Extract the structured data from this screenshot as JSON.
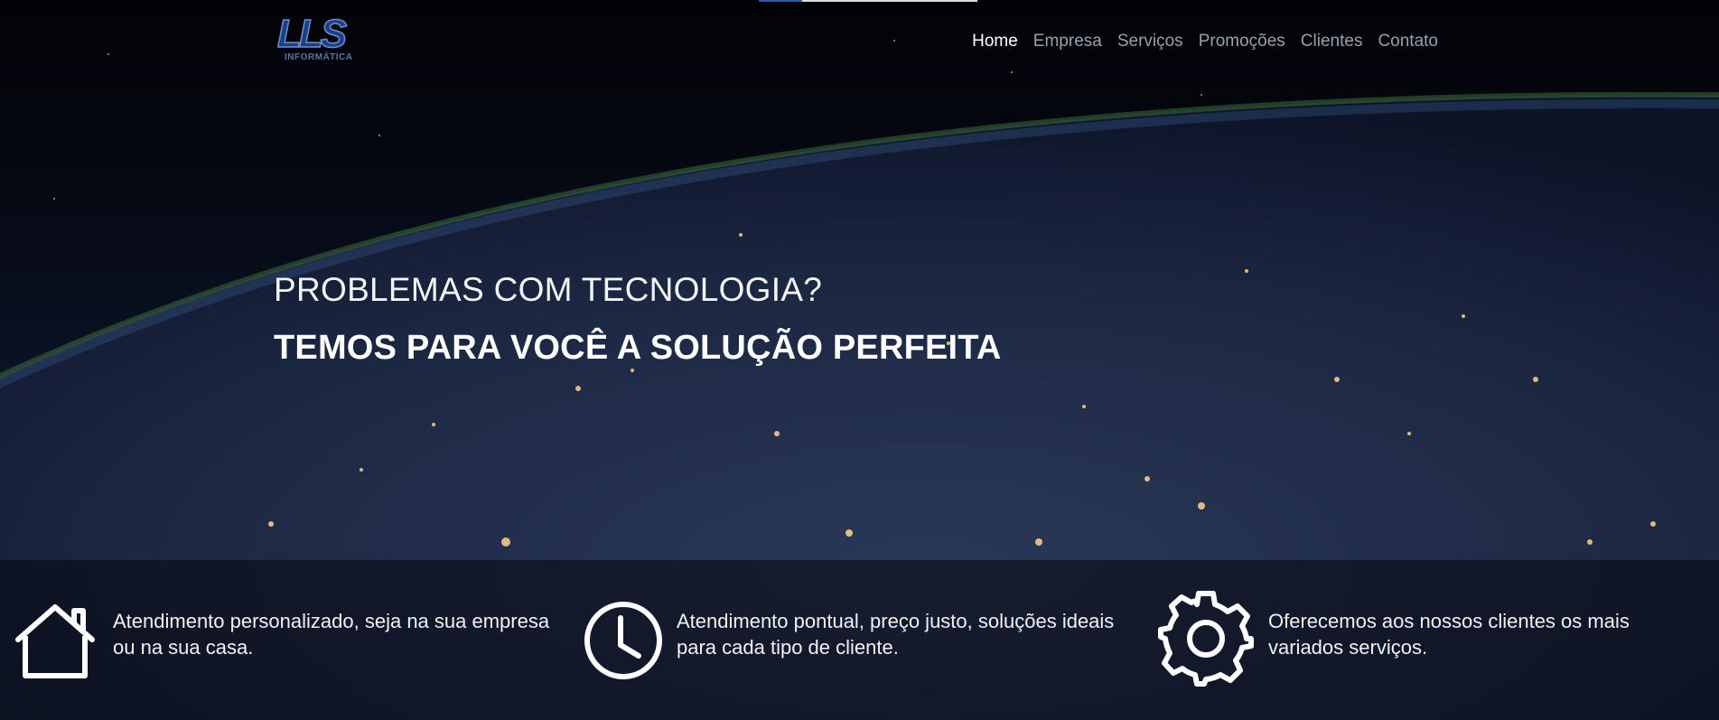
{
  "logo": {
    "mark": "LLS",
    "sub": "INFORMÁTICA"
  },
  "nav": {
    "items": [
      {
        "label": "Home",
        "active": true
      },
      {
        "label": "Empresa",
        "active": false
      },
      {
        "label": "Serviços",
        "active": false
      },
      {
        "label": "Promoções",
        "active": false
      },
      {
        "label": "Clientes",
        "active": false
      },
      {
        "label": "Contato",
        "active": false
      }
    ]
  },
  "hero": {
    "headline": "PROBLEMAS COM TECNOLOGIA?",
    "subheadline": "TEMOS PARA VOCÊ A SOLUÇÃO PERFEITA"
  },
  "features": [
    {
      "icon": "house-icon",
      "line1": "Atendimento personalizado, seja na sua empresa",
      "line2": "ou na sua casa."
    },
    {
      "icon": "clock-icon",
      "line1": "Atendimento pontual, preço justo, soluções ideais",
      "line2": "para cada tipo de cliente."
    },
    {
      "icon": "gear-icon",
      "line1": "Oferecemos aos nossos clientes os mais",
      "line2": "variados serviços."
    }
  ],
  "colors": {
    "nav_active": "#ffffff",
    "nav_inactive": "#9aa0aa",
    "logo_blue": "#1d3f8a"
  }
}
